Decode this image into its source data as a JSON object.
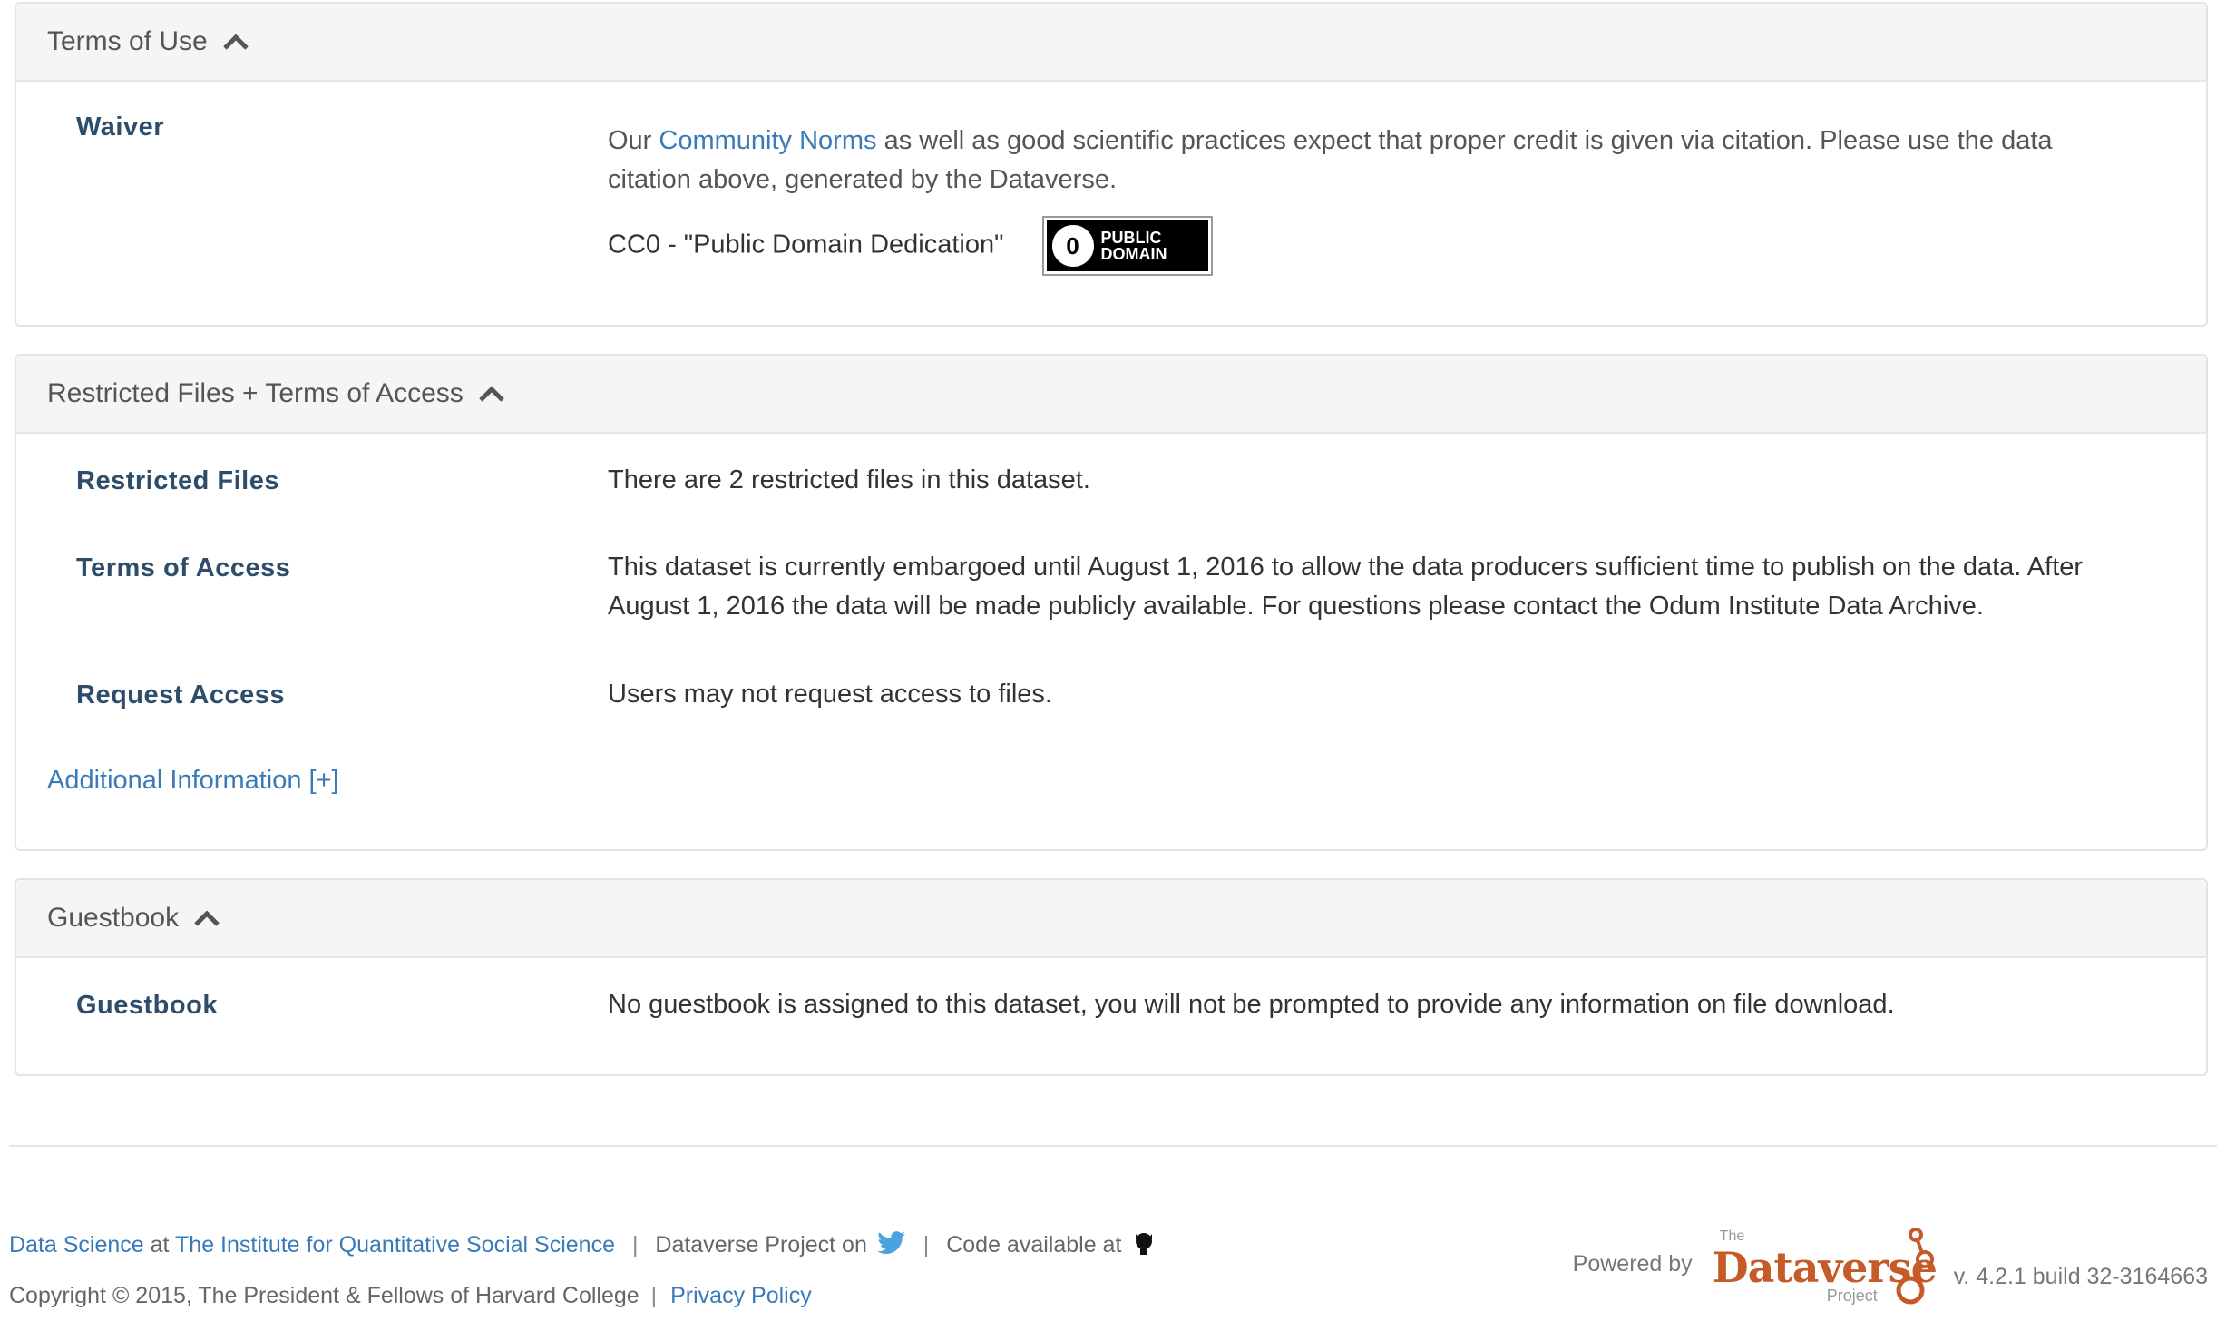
{
  "terms": {
    "heading": "Terms of Use",
    "waiver_label": "Waiver",
    "waiver_text_before": "Our",
    "waiver_link": "Community Norms",
    "waiver_text_after": "as well as good scientific practices expect that proper credit is given via citation. Please use the data citation above, generated by the Dataverse.",
    "license_text": "CC0 - \"Public Domain Dedication\"",
    "badge_line1": "PUBLIC",
    "badge_line2": "DOMAIN",
    "badge_zero": "0"
  },
  "restricted": {
    "heading": "Restricted Files + Terms of Access",
    "restricted_files_label": "Restricted Files",
    "restricted_files_value": "There are 2 restricted files in this dataset.",
    "terms_of_access_label": "Terms of Access",
    "terms_of_access_value": "This dataset is currently embargoed until August 1, 2016 to allow the data producers sufficient time to publish on the data. After August 1, 2016 the data will be made publicly available. For questions please contact the Odum Institute Data Archive.",
    "request_access_label": "Request Access",
    "request_access_value": "Users may not request access to files.",
    "additional_info_link": "Additional Information [+]"
  },
  "guestbook": {
    "heading": "Guestbook",
    "label": "Guestbook",
    "value": "No guestbook is assigned to this dataset, you will not be prompted to provide any information on file download."
  },
  "footer": {
    "data_science": "Data Science",
    "at": "at",
    "iqss": "The Institute for Quantitative Social Science",
    "sep": "|",
    "dataverse_on": "Dataverse Project on",
    "code_available": "Code available at",
    "copyright": "Copyright © 2015, The President & Fellows of Harvard College",
    "privacy": "Privacy Policy",
    "powered_by": "Powered by",
    "logo_the": "The",
    "logo_name": "Dataverse",
    "logo_project": "Project",
    "version": "v. 4.2.1 build 32-3164663"
  },
  "colors": {
    "label": "#2d4d6b",
    "link": "#3a7ab8",
    "brand": "#c55b28",
    "twitter": "#4aa3df"
  },
  "icons": [
    "chevron-up-icon",
    "cc0-public-domain-badge",
    "twitter-icon",
    "github-icon",
    "dataverse-logo"
  ]
}
